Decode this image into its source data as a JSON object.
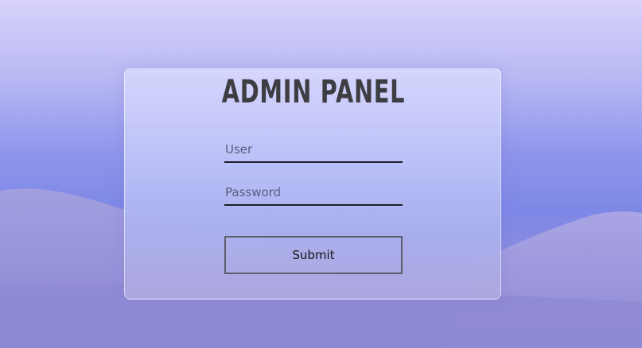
{
  "login": {
    "title": "ADMIN PANEL",
    "user_placeholder": "User",
    "password_placeholder": "Password",
    "submit_label": "Submit"
  }
}
